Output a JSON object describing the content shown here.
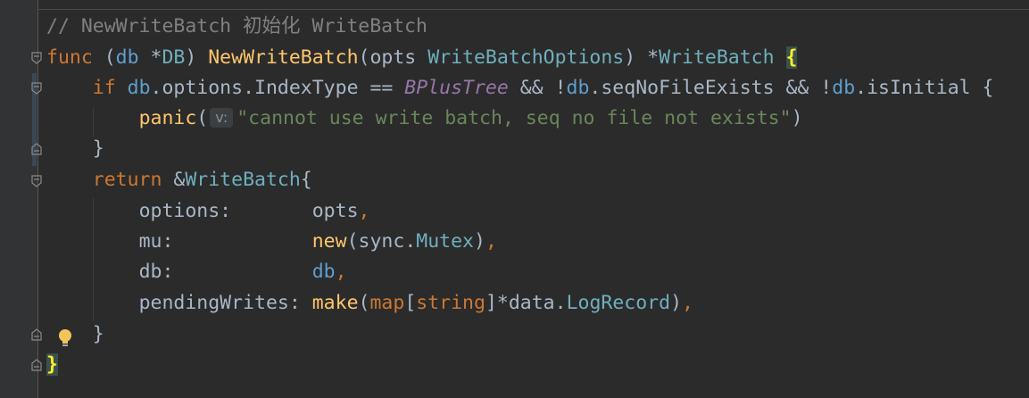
{
  "editor": {
    "comment": "// NewWriteBatch 初始化 WriteBatch",
    "lines": {
      "l1": {
        "kw_func": "func",
        "paren_open": " (",
        "recv": "db",
        "star": " *",
        "recv_type": "DB",
        "paren_close": ") ",
        "fn_name": "NewWriteBatch",
        "args_open": "(",
        "param": "opts",
        "space": " ",
        "param_type": "WriteBatchOptions",
        "args_close": ") *",
        "ret_type": "WriteBatch",
        "space2": " ",
        "brace": "{"
      },
      "l2": {
        "indent": "    ",
        "kw_if": "if",
        "sp": " ",
        "db1": "db",
        "t1": ".options.IndexType == ",
        "const": "BPlusTree",
        "t2": " && !",
        "db2": "db",
        "t3": ".seqNoFileExists && !",
        "db3": "db",
        "t4": ".isInitial {"
      },
      "l3": {
        "indent": "        ",
        "fn_panic": "panic",
        "open": "(",
        "hint": "v:",
        "str": "\"cannot use write batch, seq no file not exists\"",
        "close": ")"
      },
      "l4": {
        "text": "    }"
      },
      "l5": {
        "indent": "    ",
        "kw_return": "return",
        "amp": " &",
        "type": "WriteBatch",
        "brace": "{"
      },
      "l6": {
        "indent": "        ",
        "key": "options:       ",
        "val": "opts",
        "comma": ","
      },
      "l7": {
        "indent": "        ",
        "key": "mu:            ",
        "kw_new": "new",
        "open": "(",
        "pkg": "sync",
        "dot": ".",
        "type": "Mutex",
        "close": ")",
        "comma": ","
      },
      "l8": {
        "indent": "        ",
        "key": "db:            ",
        "val": "db",
        "comma": ","
      },
      "l9": {
        "indent": "        ",
        "key": "pendingWrites: ",
        "fn_make": "make",
        "open": "(",
        "kw_map": "map",
        "lb": "[",
        "string": "string",
        "rb": "]*",
        "pkg": "data",
        "dot": ".",
        "type": "LogRecord",
        "close": ")",
        "comma": ","
      },
      "l10": {
        "text": "    }"
      },
      "l11": {
        "text": "}"
      }
    }
  },
  "colors": {
    "background": "#2b2b2b",
    "keyword": "#cc7832",
    "function": "#ffc66d",
    "type": "#6fafbd",
    "constant": "#9876aa",
    "string": "#6a8759",
    "comment": "#808080",
    "text": "#a9b7c6"
  },
  "icons": [
    "fold-icon",
    "lightbulb-icon"
  ]
}
